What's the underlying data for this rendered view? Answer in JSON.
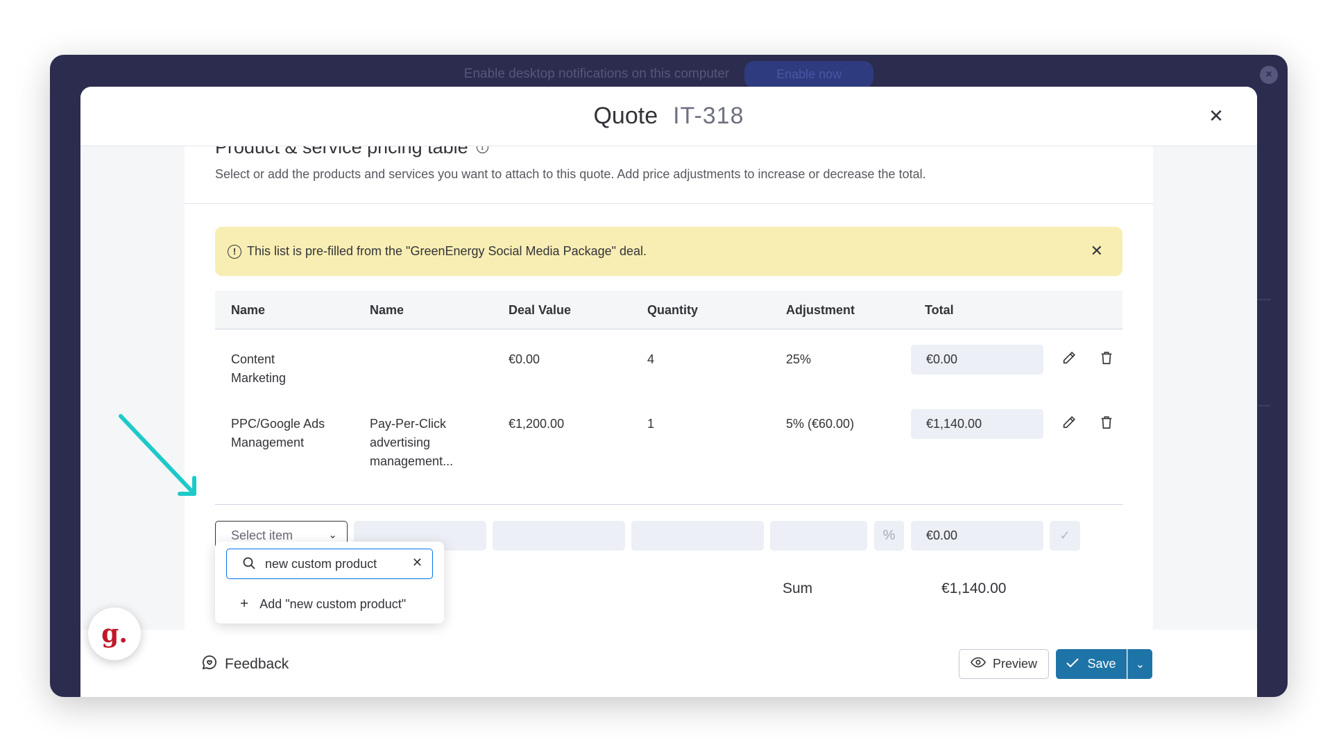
{
  "notification": {
    "text": "Enable desktop notifications on this computer",
    "button": "Enable now"
  },
  "modal": {
    "title": "Quote",
    "id": "IT-318"
  },
  "section": {
    "title": "Product & service pricing table",
    "description": "Select or add the products and services you want to attach to this quote. Add price adjustments to increase or decrease the total."
  },
  "alert": {
    "text": "This list is pre-filled from the \"GreenEnergy Social Media Package\" deal."
  },
  "table": {
    "headers": [
      "Name",
      "Name",
      "Deal Value",
      "Quantity",
      "Adjustment",
      "Total"
    ],
    "rows": [
      {
        "name": "Content\nMarketing",
        "description": "",
        "deal_value": "€0.00",
        "quantity": "4",
        "adjustment": "25%",
        "total": "€0.00"
      },
      {
        "name": "PPC/Google Ads\nManagement",
        "description": "Pay-Per-Click\nadvertising\nmanagement...",
        "deal_value": "€1,200.00",
        "quantity": "1",
        "adjustment": "5% (€60.00)",
        "total": "€1,140.00"
      }
    ]
  },
  "new_row": {
    "select_placeholder": "Select item",
    "percent_symbol": "%",
    "total": "€0.00"
  },
  "dropdown": {
    "search_value": "new custom product",
    "add_option": "Add \"new custom product\""
  },
  "summary": {
    "sum_label": "Sum",
    "sum_value": "€1,140.00"
  },
  "footer": {
    "feedback": "Feedback",
    "preview": "Preview",
    "save": "Save"
  },
  "avatar": {
    "letter": "g."
  },
  "colors": {
    "accent": "#1f74a7",
    "alert_bg": "#f8eeb4",
    "arrow": "#1ec9c9",
    "window_bg": "#2b2c4e"
  }
}
